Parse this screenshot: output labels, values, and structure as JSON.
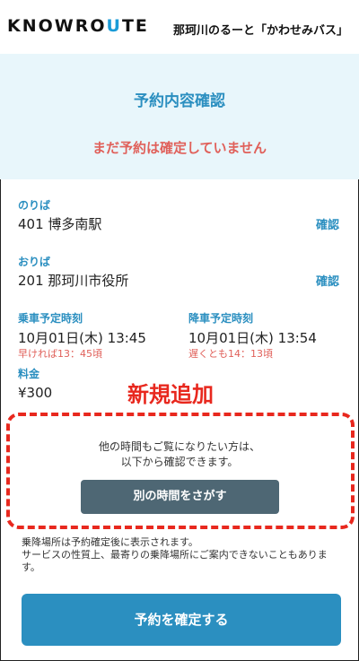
{
  "header": {
    "logo_pre": "KNOWRO",
    "logo_u": "U",
    "logo_post": "TE",
    "service_name": "那珂川のるーと「かわせみバス」"
  },
  "confirm": {
    "title": "予約内容確認",
    "warning": "まだ予約は確定していません"
  },
  "pickup": {
    "label": "のりば",
    "value": "401 博多南駅",
    "check": "確認"
  },
  "dropoff": {
    "label": "おりば",
    "value": "201 那珂川市役所",
    "check": "確認"
  },
  "boarding": {
    "label": "乗車予定時刻",
    "value": "10月01日(木) 13:45",
    "note": "早ければ13：45頃"
  },
  "alighting": {
    "label": "降車予定時刻",
    "value": "10月01日(木) 13:54",
    "note": "遅くとも14：13頃"
  },
  "fare": {
    "label": "料金",
    "value": "¥300"
  },
  "annotation": {
    "new_label": "新規追加"
  },
  "alternative": {
    "line1": "他の時間もご覧になりたい方は、",
    "line2": "以下から確認できます。",
    "button": "別の時間をさがす"
  },
  "info": {
    "line1": "乗降場所は予約確定後に表示されます。",
    "line2": "サービスの性質上、最寄りの乗降場所にご案内できないこともあります。"
  },
  "confirm_button": "予約を確定する",
  "colors": {
    "accent": "#2b8fc0",
    "warning": "#e0605a",
    "annotation": "#e8281e",
    "panel": "#e8f6fb",
    "secondary_button": "#4e6774"
  }
}
